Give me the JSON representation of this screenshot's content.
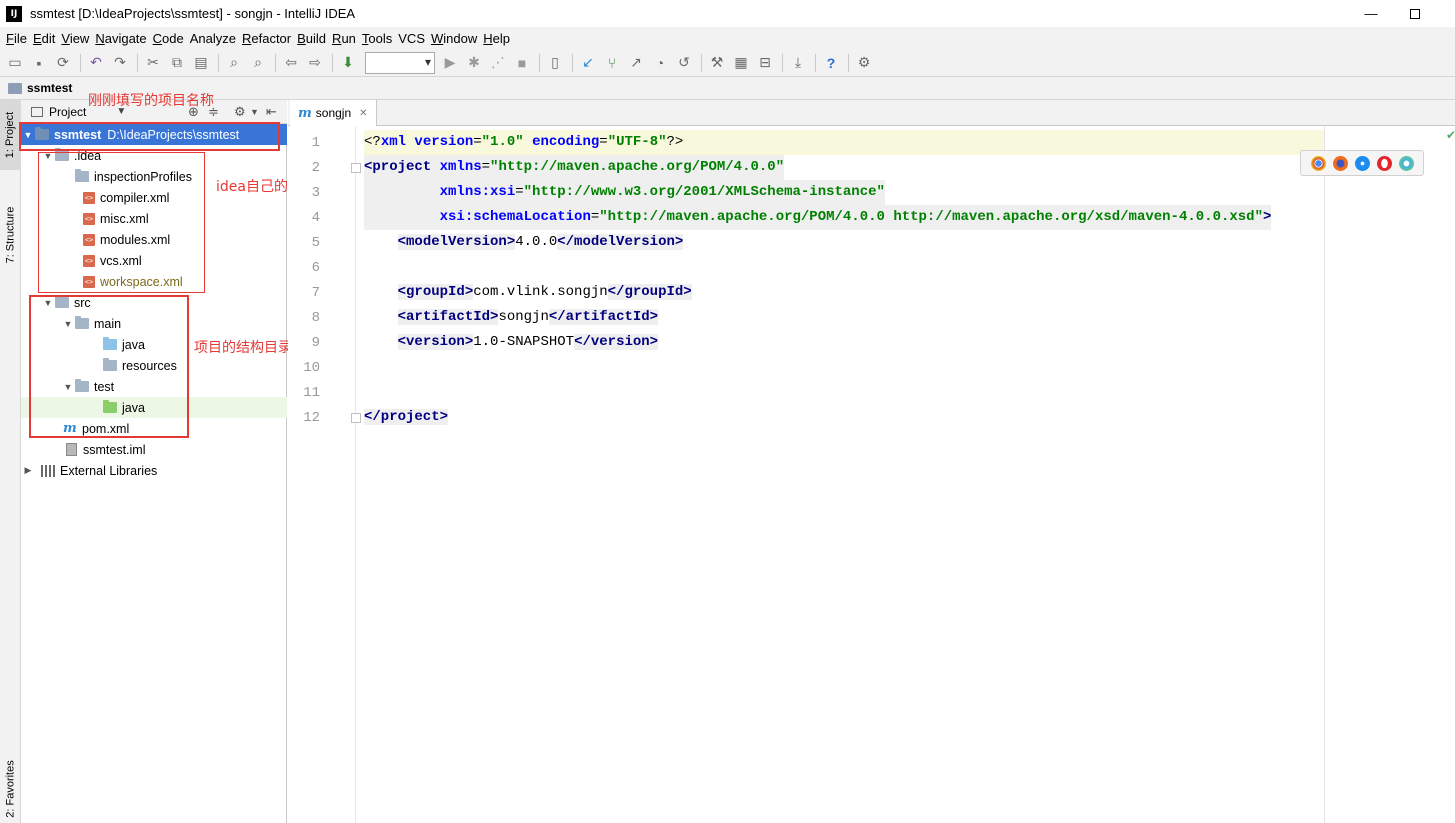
{
  "window": {
    "app_icon": "IJ",
    "title": "ssmtest [D:\\IdeaProjects\\ssmtest] - songjn - IntelliJ IDEA",
    "minimize": "—"
  },
  "menu": [
    {
      "mnemonic": "F",
      "rest": "ile"
    },
    {
      "mnemonic": "E",
      "rest": "dit"
    },
    {
      "mnemonic": "V",
      "rest": "iew"
    },
    {
      "mnemonic": "N",
      "rest": "avigate"
    },
    {
      "mnemonic": "C",
      "rest": "ode"
    },
    {
      "mnemonic": "",
      "rest": "Analyze"
    },
    {
      "mnemonic": "R",
      "rest": "efactor"
    },
    {
      "mnemonic": "B",
      "rest": "uild"
    },
    {
      "mnemonic": "R",
      "rest": "un"
    },
    {
      "mnemonic": "T",
      "rest": "ools"
    },
    {
      "mnemonic": "",
      "rest": "VCS"
    },
    {
      "mnemonic": "W",
      "rest": "indow"
    },
    {
      "mnemonic": "H",
      "rest": "elp"
    }
  ],
  "toolbar": {
    "icons": [
      "open-icon",
      "save-icon",
      "sync-icon",
      "undo-icon",
      "redo-icon",
      "cut-icon",
      "copy-icon",
      "paste-icon",
      "find-icon",
      "replace-icon",
      "back-icon",
      "forward-icon",
      "build-icon",
      "run-config-combo",
      "run-icon",
      "debug-icon",
      "coverage-icon",
      "stop-icon",
      "attach-icon",
      "vcs-update-icon",
      "vcs-commit-icon",
      "vcs-compare-icon",
      "vcs-history-icon",
      "vcs-revert-icon",
      "settings-icon",
      "project-structure-icon",
      "sdk-icon",
      "help-icon",
      "plugin-icon"
    ]
  },
  "navbar": {
    "crumb": "ssmtest"
  },
  "tool_windows": {
    "project": "1: Project",
    "structure": "7: Structure",
    "favorites": "2: Favorites"
  },
  "project_panel": {
    "view_label": "Project",
    "tree": [
      {
        "label": "ssmtest",
        "path": "D:\\IdeaProjects\\ssmtest"
      },
      {
        "label": ".idea"
      },
      {
        "label": "inspectionProfiles"
      },
      {
        "label": "compiler.xml"
      },
      {
        "label": "misc.xml"
      },
      {
        "label": "modules.xml"
      },
      {
        "label": "vcs.xml"
      },
      {
        "label": "workspace.xml"
      },
      {
        "label": "src"
      },
      {
        "label": "main"
      },
      {
        "label": "java"
      },
      {
        "label": "resources"
      },
      {
        "label": "test"
      },
      {
        "label": "java"
      },
      {
        "label": "pom.xml"
      },
      {
        "label": "ssmtest.iml"
      },
      {
        "label": "External Libraries"
      }
    ]
  },
  "annotations": {
    "project_name": "刚刚填写的项目名称",
    "idea_files": "idea自己的文件",
    "structure": "项目的结构目录"
  },
  "editor": {
    "tab_label": "songjn",
    "line_numbers": [
      "1",
      "2",
      "3",
      "4",
      "5",
      "6",
      "7",
      "8",
      "9",
      "10",
      "11",
      "12"
    ],
    "code": {
      "l1_pi_open": "<?",
      "l1_xml": "xml",
      "l1_version_attr": " version",
      "l1_eq1": "=",
      "l1_version_val": "\"1.0\"",
      "l1_encoding_attr": " encoding",
      "l1_eq2": "=",
      "l1_encoding_val": "\"UTF-8\"",
      "l1_pi_close": "?>",
      "l2_open": "<project",
      "l2_attr": " xmlns",
      "l2_eq": "=",
      "l2_val": "\"http://maven.apache.org/POM/4.0.0\"",
      "l3_indent": "         ",
      "l3_attr": "xmlns:xsi",
      "l3_eq": "=",
      "l3_val": "\"http://www.w3.org/2001/XMLSchema-instance\"",
      "l4_indent": "         ",
      "l4_attr": "xsi:schemaLocation",
      "l4_eq": "=",
      "l4_val": "\"http://maven.apache.org/POM/4.0.0 http://maven.apache.org/xsd/maven-4.0.0.xsd\"",
      "l4_close": ">",
      "l5_indent": "    ",
      "l5_open": "<modelVersion>",
      "l5_text": "4.0.0",
      "l5_close": "</modelVersion>",
      "l7_indent": "    ",
      "l7_open": "<groupId>",
      "l7_text": "com.vlink.songjn",
      "l7_close": "</groupId>",
      "l8_indent": "    ",
      "l8_open": "<artifactId>",
      "l8_text": "songjn",
      "l8_close": "</artifactId>",
      "l9_indent": "    ",
      "l9_open": "<version>",
      "l9_text": "1.0-SNAPSHOT",
      "l9_close": "</version>",
      "l12_close": "</project>"
    },
    "browsers": [
      "chrome-icon",
      "firefox-icon",
      "safari-icon",
      "opera-icon",
      "ie-icon"
    ]
  },
  "colors": {
    "selection": "#3875d7",
    "annotation_red": "#e53935",
    "xml_tag": "#000080",
    "xml_attr": "#0000ff",
    "xml_value": "#008000"
  }
}
